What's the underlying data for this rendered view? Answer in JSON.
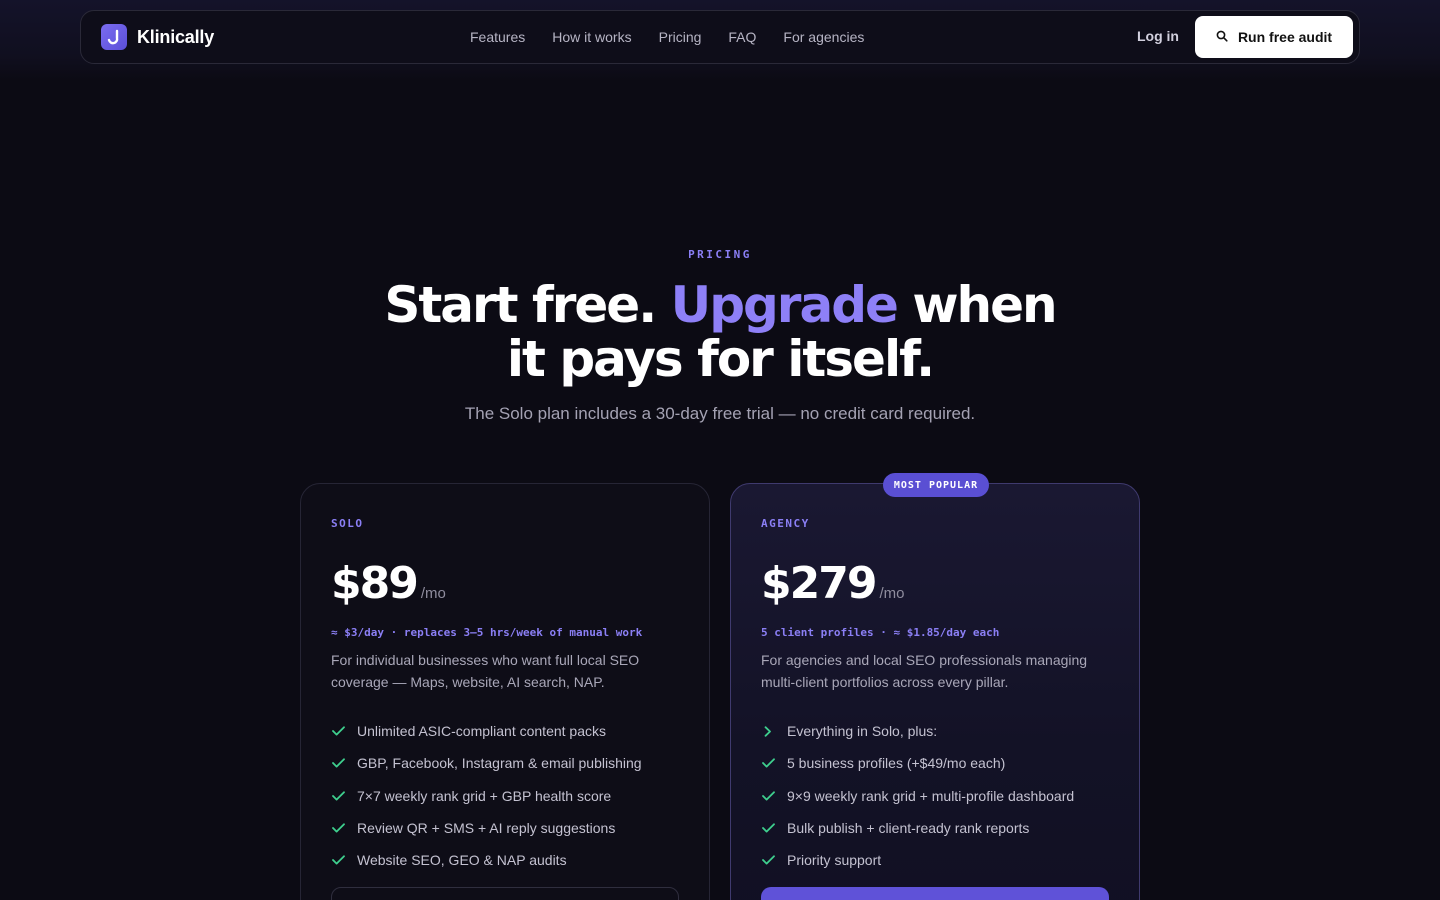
{
  "brand": {
    "name": "Klinically"
  },
  "nav": {
    "links": [
      "Features",
      "How it works",
      "Pricing",
      "FAQ",
      "For agencies"
    ],
    "login": "Log in",
    "cta": "Run free audit"
  },
  "hero": {
    "eyebrow": "PRICING",
    "title_part1": "Start free. ",
    "title_accent": "Upgrade",
    "title_part2": " when",
    "title_line2": "it pays for itself.",
    "subtitle": "The Solo plan includes a 30-day free trial — no credit card required."
  },
  "plans": [
    {
      "tier": "SOLO",
      "price": "$89",
      "period": "/mo",
      "note": "≈ $3/day · replaces 3–5 hrs/week of manual work",
      "description": "For individual businesses who want full local SEO coverage — Maps, website, AI search, NAP.",
      "features": [
        "Unlimited ASIC-compliant content packs",
        "GBP, Facebook, Instagram & email publishing",
        "7×7 weekly rank grid + GBP health score",
        "Review QR + SMS + AI reply suggestions",
        "Website SEO, GEO & NAP audits"
      ]
    },
    {
      "badge": "MOST POPULAR",
      "tier": "AGENCY",
      "price": "$279",
      "period": "/mo",
      "note": "5 client profiles · ≈ $1.85/day each",
      "description": "For agencies and local SEO professionals managing multi-client portfolios across every pillar.",
      "features": [
        "Everything in Solo, plus:",
        "5 business profiles (+$49/mo each)",
        "9×9 weekly rank grid + multi-profile dashboard",
        "Bulk publish + client-ready rank reports",
        "Priority support"
      ]
    }
  ],
  "colors": {
    "accent": "#8e80f7",
    "check": "#3ecf8e",
    "badge": "#5a4fd3"
  },
  "icons": {
    "search": "search-icon",
    "check": "check-icon",
    "chevron": "chevron-right-icon"
  }
}
